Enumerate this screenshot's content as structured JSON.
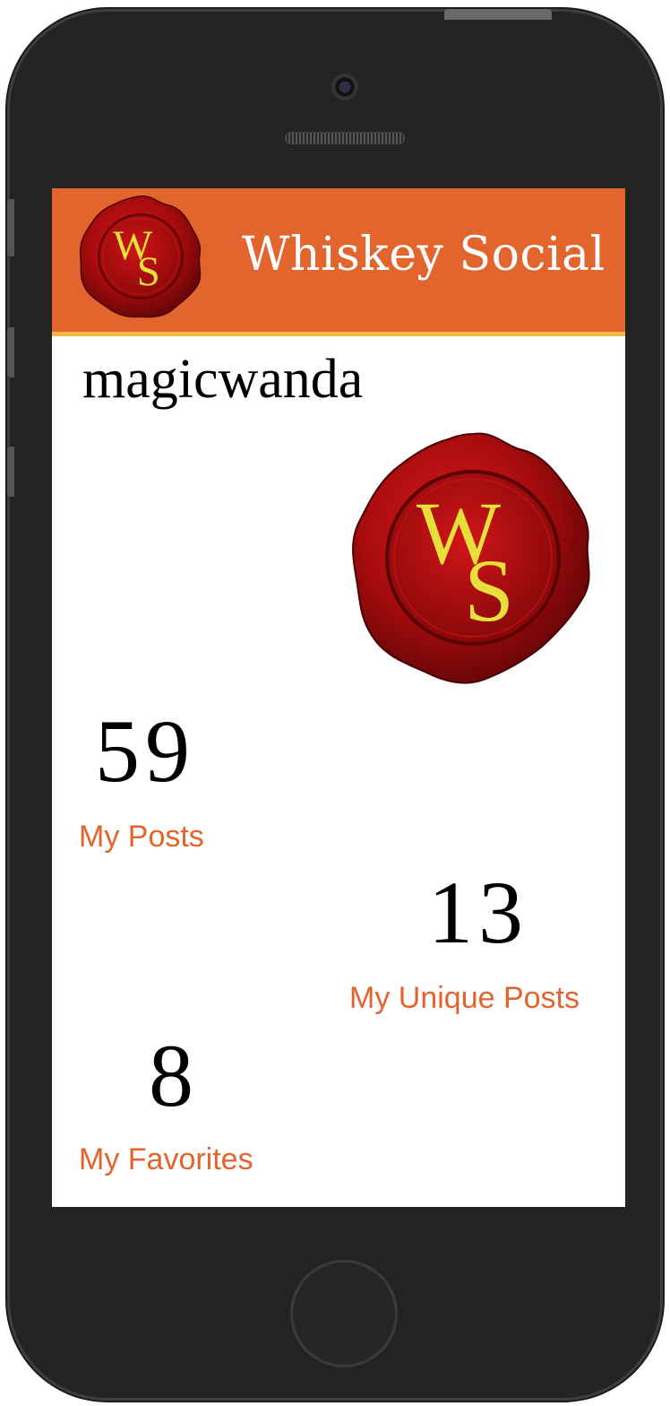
{
  "app": {
    "title": "Whiskey Social",
    "logo_monogram_top": "W",
    "logo_monogram_bottom": "S"
  },
  "profile": {
    "username": "magicwanda"
  },
  "stats": [
    {
      "value": "59",
      "label": "My Posts"
    },
    {
      "value": "13",
      "label": "My Unique Posts"
    },
    {
      "value": "8",
      "label": "My Favorites"
    }
  ],
  "colors": {
    "header_bg": "#e2652d",
    "header_accent": "#f7b548",
    "link": "#e2652d",
    "seal_red": "#a80c0c",
    "seal_letters": "#e8e03a",
    "device_body": "#232323"
  }
}
